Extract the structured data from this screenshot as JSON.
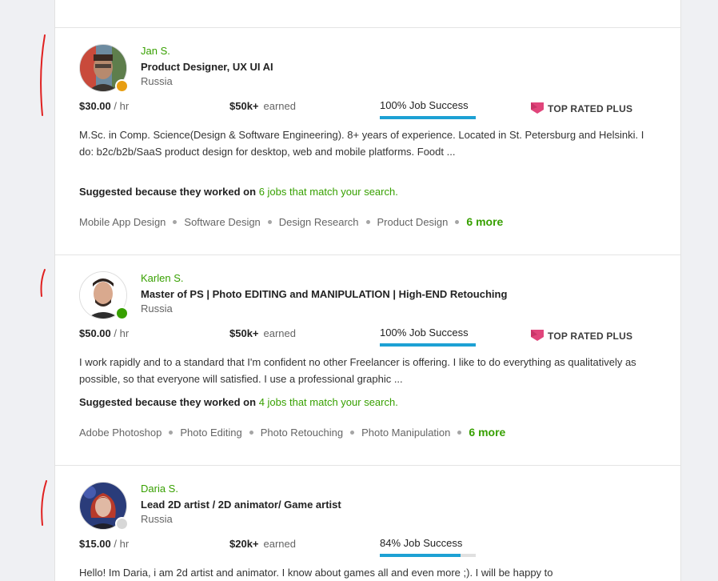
{
  "colors": {
    "brand_green": "#37a000",
    "job_success_blue": "#1da1d4",
    "top_rated_pink": "#e0457b",
    "status_away": "#e89e12",
    "status_online": "#37a000",
    "status_offline": "#d7d7d7"
  },
  "freelancers": [
    {
      "name": "Jan S.",
      "title": "Product Designer, UX UI AI",
      "country": "Russia",
      "rate": "$30.00",
      "rate_unit": "/ hr",
      "earned_amount": "$50k+",
      "earned_label": "earned",
      "job_success": "100% Job Success",
      "job_success_level": 1.0,
      "badge": "TOP RATED PLUS",
      "status": "away",
      "avatar_icon": "person-photo-icon",
      "description": "M.Sc. in Comp. Science(Design & Software Engineering). 8+ years of experience. Located in St. Petersburg and Helsinki. I do: b2c/b2b/SaaS product design for desktop, web and mobile platforms. Foodt ...",
      "suggest_prefix": "Suggested because they worked on",
      "suggest_link": "6 jobs that match your search.",
      "skills": [
        "Mobile App Design",
        "Software Design",
        "Design Research",
        "Product Design"
      ],
      "more": "6 more"
    },
    {
      "name": "Karlen S.",
      "title": "Master of PS | Photo EDITING and MANIPULATION | High-END Retouching",
      "country": "Russia",
      "rate": "$50.00",
      "rate_unit": "/ hr",
      "earned_amount": "$50k+",
      "earned_label": "earned",
      "job_success": "100% Job Success",
      "job_success_level": 1.0,
      "badge": "TOP RATED PLUS",
      "status": "online",
      "avatar_icon": "person-photo-icon",
      "description": "I work rapidly and to a standard that I'm confident no other Freelancer is offering. I like to do everything as qualitatively as possible, so that everyone will satisfied. I use a professional graphic ...",
      "suggest_prefix": "Suggested because they worked on",
      "suggest_link": "4 jobs that match your search.",
      "skills": [
        "Adobe Photoshop",
        "Photo Editing",
        "Photo Retouching",
        "Photo Manipulation"
      ],
      "more": "6 more"
    },
    {
      "name": "Daria S.",
      "title": "Lead 2D artist / 2D animator/ Game artist",
      "country": "Russia",
      "rate": "$15.00",
      "rate_unit": "/ hr",
      "earned_amount": "$20k+",
      "earned_label": "earned",
      "job_success": "84% Job Success",
      "job_success_level": 0.84,
      "badge": "",
      "status": "offline",
      "avatar_icon": "person-photo-icon",
      "description": "Hello! Im Daria, i am 2d artist and animator. I know about games all and even more ;). I will be happy to"
    }
  ]
}
